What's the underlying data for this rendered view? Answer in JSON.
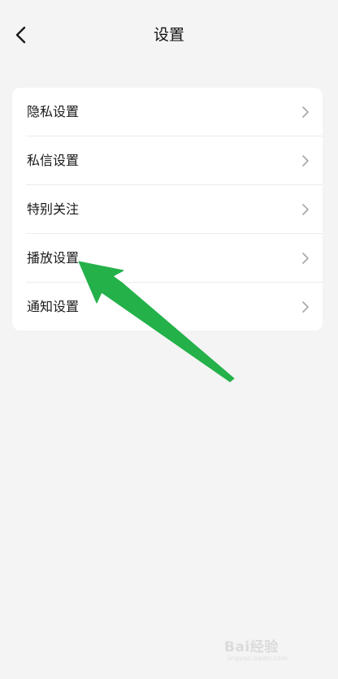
{
  "header": {
    "title": "设置",
    "back_icon": "chevron-left-icon"
  },
  "settings": {
    "items": [
      {
        "label": "隐私设置",
        "icon": "chevron-right-icon"
      },
      {
        "label": "私信设置",
        "icon": "chevron-right-icon"
      },
      {
        "label": "特别关注",
        "icon": "chevron-right-icon"
      },
      {
        "label": "播放设置",
        "icon": "chevron-right-icon"
      },
      {
        "label": "通知设置",
        "icon": "chevron-right-icon"
      }
    ]
  },
  "annotation": {
    "arrow_color": "#24b14a",
    "target": "播放设置"
  },
  "watermark": {
    "text": "Bai经验",
    "subtext": "jingyan.baidu.com"
  },
  "colors": {
    "background": "#f4f4f4",
    "card": "#ffffff",
    "chevron": "#a6a6a6",
    "divider": "#ececec"
  }
}
